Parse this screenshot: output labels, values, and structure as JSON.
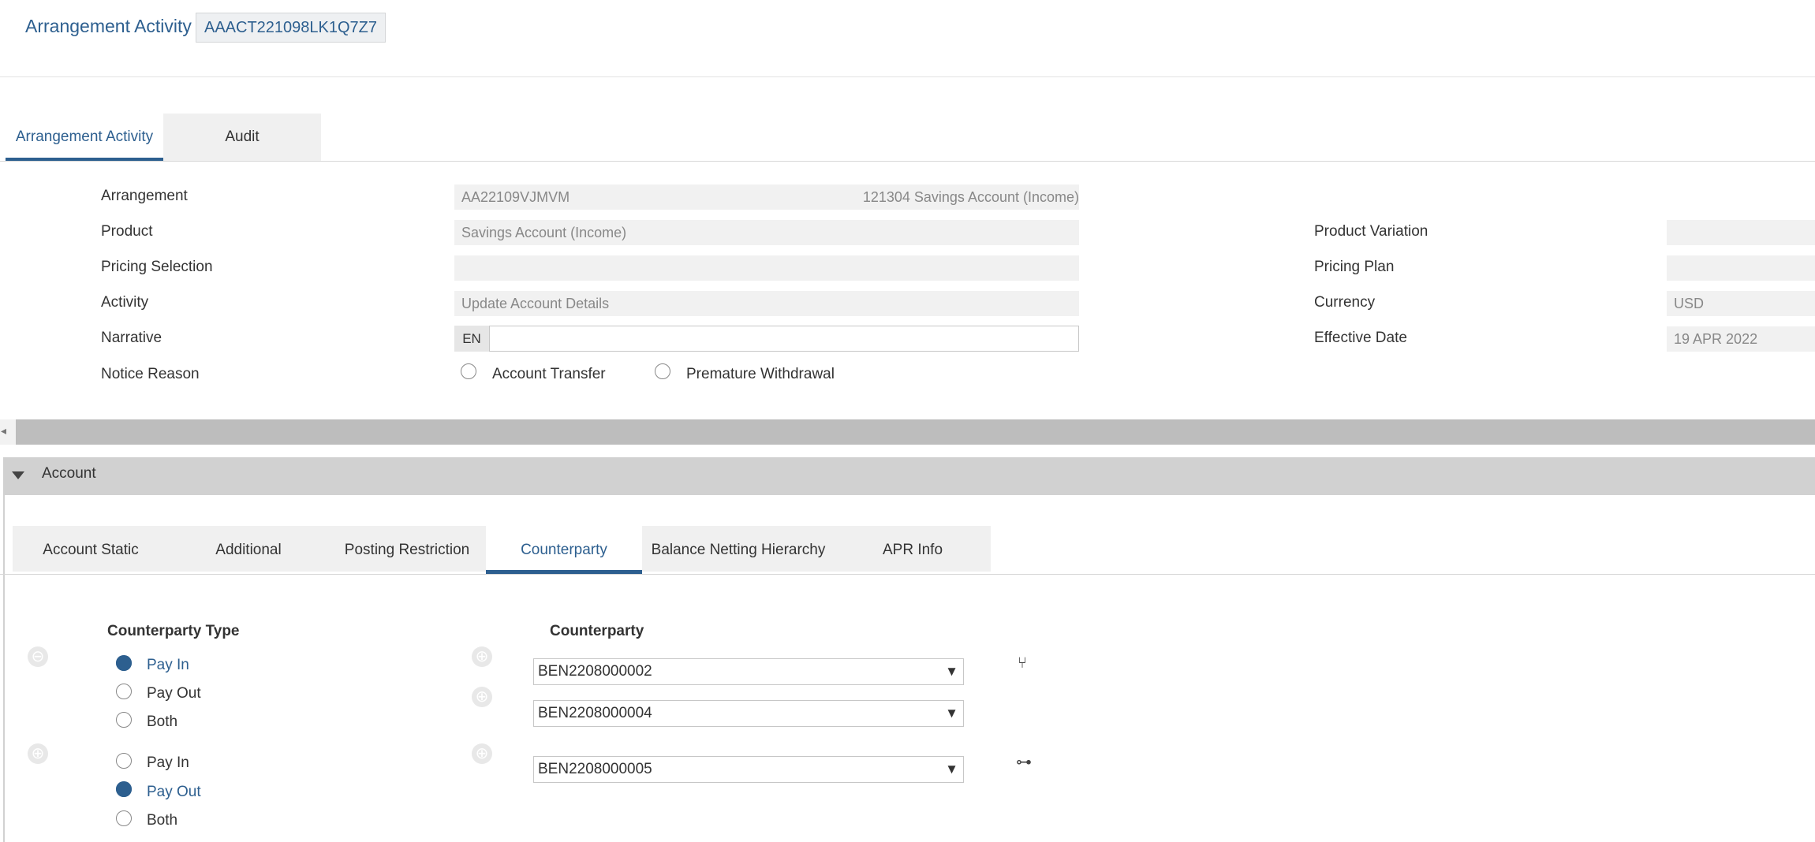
{
  "header": {
    "title": "Arrangement Activity",
    "activity_id": "AAACT221098LK1Q7Z7"
  },
  "top_tabs": [
    {
      "label": "Arrangement Activity",
      "active": true
    },
    {
      "label": "Audit",
      "active": false
    }
  ],
  "form": {
    "arrangement": {
      "label": "Arrangement",
      "value": "AA22109VJMVM",
      "description": "121304 Savings Account (Income)"
    },
    "product": {
      "label": "Product",
      "value": "Savings Account (Income)"
    },
    "pricing_selection": {
      "label": "Pricing Selection",
      "value": ""
    },
    "activity": {
      "label": "Activity",
      "value": "Update Account Details"
    },
    "narrative": {
      "label": "Narrative",
      "lang": "EN",
      "value": ""
    },
    "notice_reason": {
      "label": "Notice Reason",
      "options": [
        "Account Transfer",
        "Premature Withdrawal"
      ]
    },
    "product_variation": {
      "label": "Product Variation",
      "value": ""
    },
    "pricing_plan": {
      "label": "Pricing Plan",
      "value": ""
    },
    "currency": {
      "label": "Currency",
      "value": "USD"
    },
    "effective_date": {
      "label": "Effective Date",
      "value": "19 APR 2022"
    }
  },
  "section": {
    "title": "Account"
  },
  "sub_tabs": [
    {
      "label": "Account Static",
      "active": false
    },
    {
      "label": "Additional",
      "active": false
    },
    {
      "label": "Posting Restriction",
      "active": false
    },
    {
      "label": "Counterparty",
      "active": true
    },
    {
      "label": "Balance Netting Hierarchy",
      "active": false
    },
    {
      "label": "APR Info",
      "active": false
    }
  ],
  "counterparty": {
    "type_header": "Counterparty Type",
    "cp_header": "Counterparty",
    "groups": [
      {
        "options": [
          "Pay In",
          "Pay Out",
          "Both"
        ],
        "selected": "Pay In",
        "counterparties": [
          "BEN2208000002",
          "BEN2208000004"
        ]
      },
      {
        "options": [
          "Pay In",
          "Pay Out",
          "Both"
        ],
        "selected": "Pay Out",
        "counterparties": [
          "BEN2208000005"
        ]
      }
    ]
  },
  "icons": {
    "collapse": "triangle-down-icon",
    "group1_tool": "hierarchy-icon",
    "group2_tool": "link-icon"
  },
  "colors": {
    "accent": "#2d5f8f"
  }
}
